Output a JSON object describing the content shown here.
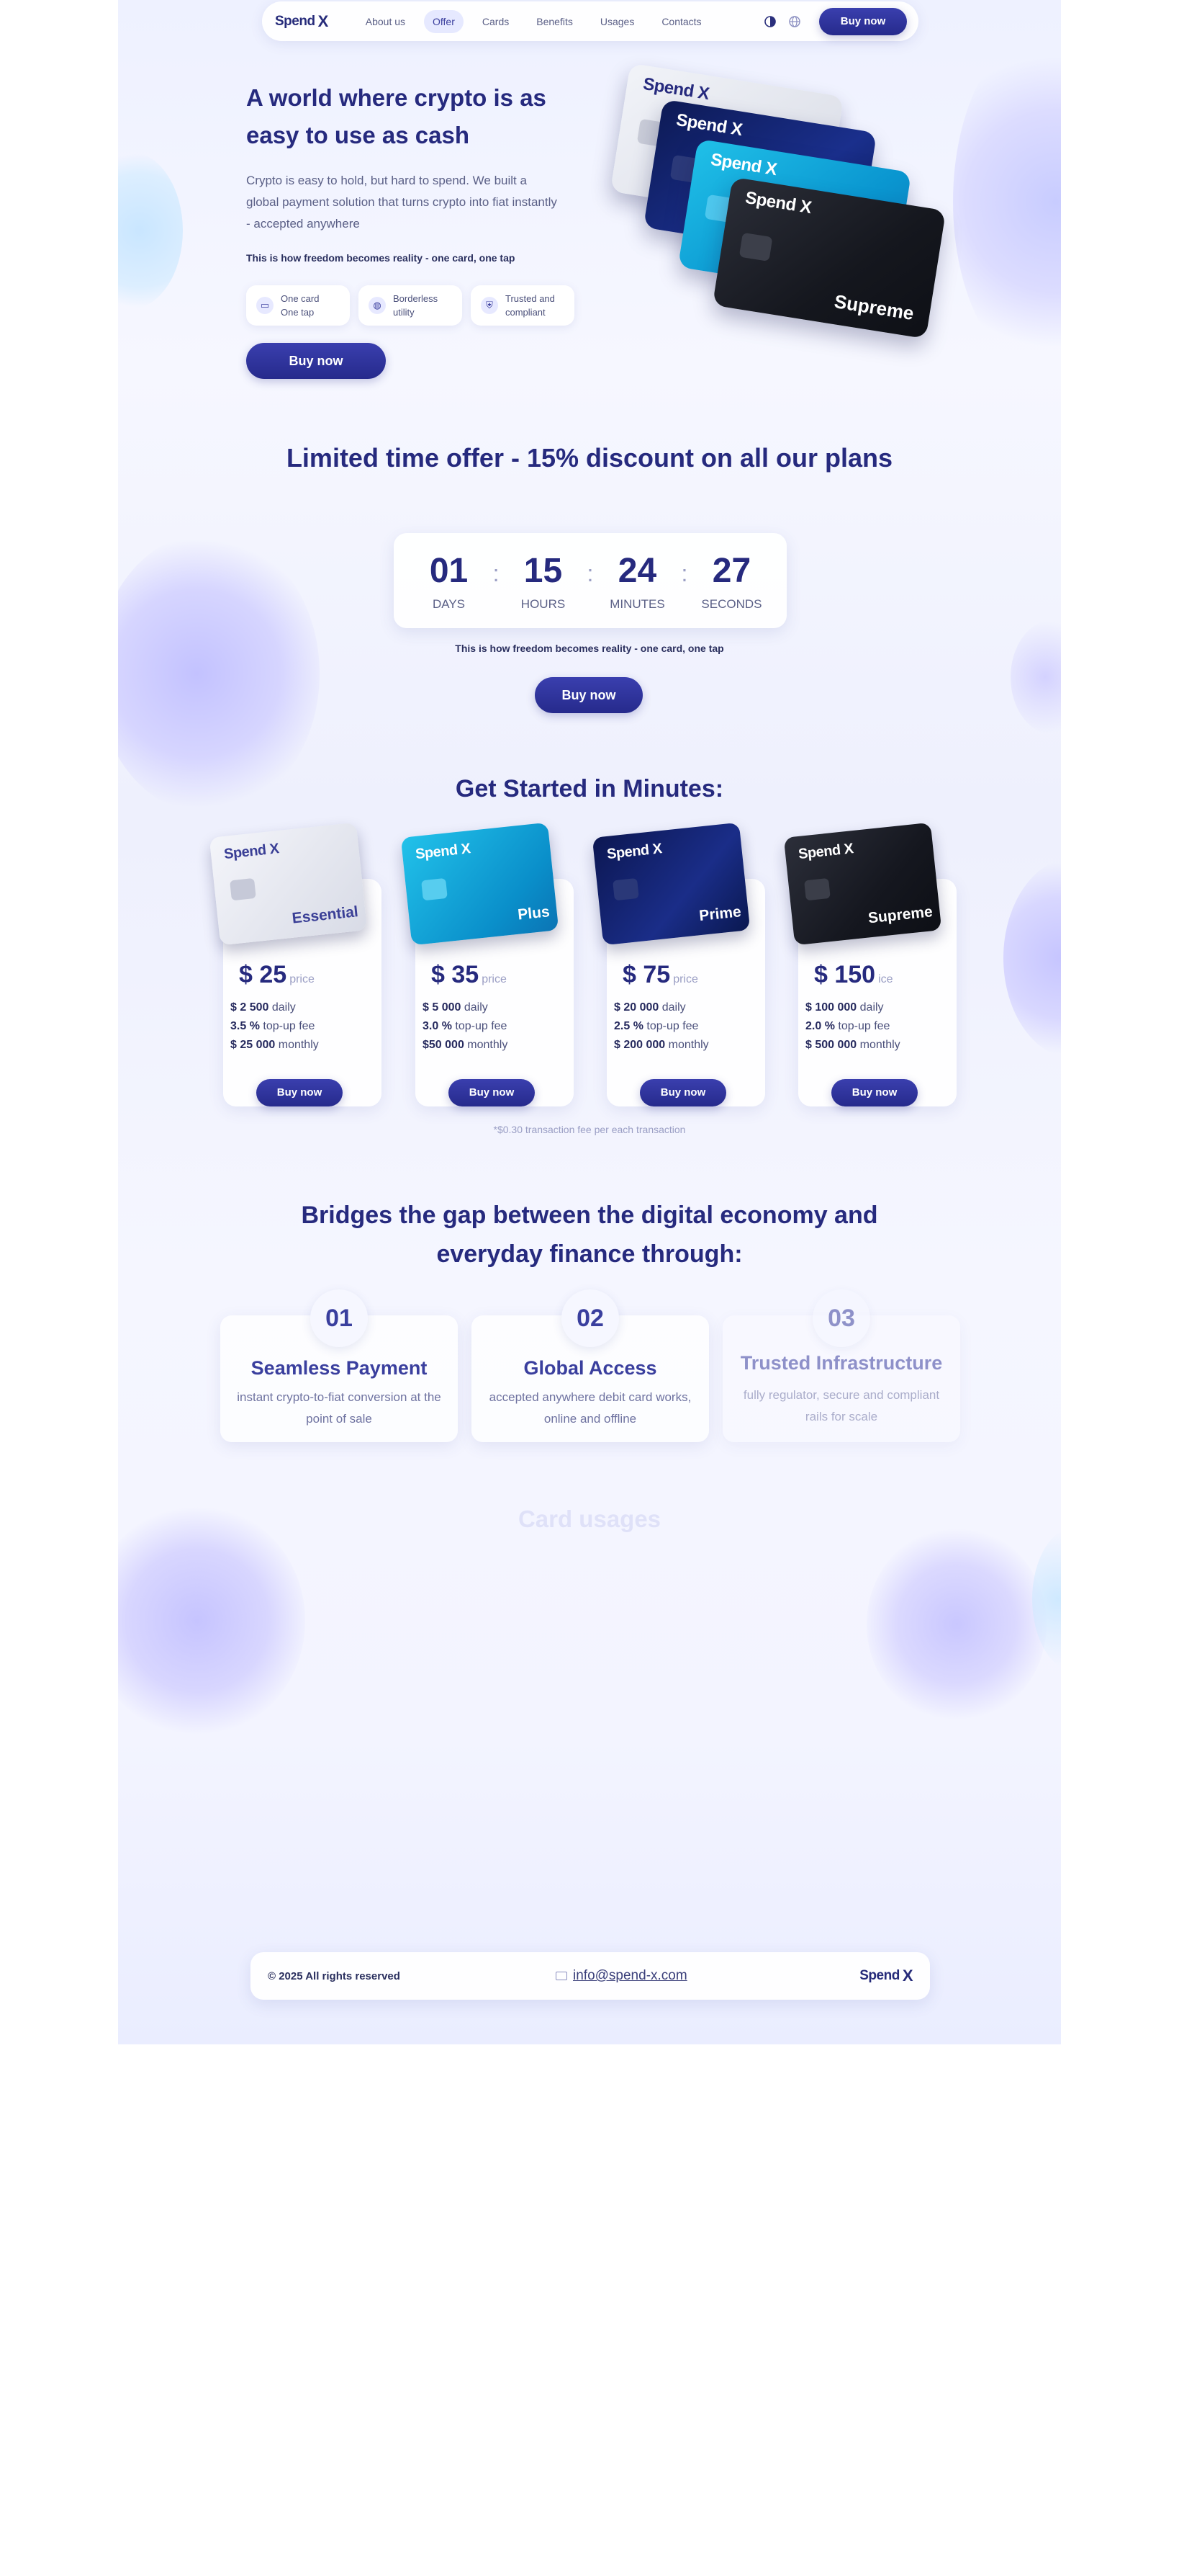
{
  "nav": {
    "brand": "Spend",
    "brand_mark": "X",
    "links": [
      {
        "label": "About us",
        "active": false
      },
      {
        "label": "Offer",
        "active": true
      },
      {
        "label": "Cards",
        "active": false
      },
      {
        "label": "Benefits",
        "active": false
      },
      {
        "label": "Usages",
        "active": false
      },
      {
        "label": "Contacts",
        "active": false
      }
    ],
    "icons": [
      "theme-toggle-icon",
      "globe-icon"
    ],
    "buy_label": "Buy now"
  },
  "hero": {
    "title": "A world where crypto is as easy to use as cash",
    "description": "Crypto is easy to hold, but hard to spend. We built a global payment solution that turns crypto into fiat instantly - accepted anywhere",
    "tagline": "This is how freedom becomes reality - one card, one tap",
    "features": [
      {
        "icon": "card-icon",
        "text": "One card One tap"
      },
      {
        "icon": "globe-icon",
        "text": "Borderless utility"
      },
      {
        "icon": "shield-icon",
        "text": "Trusted and compliant"
      }
    ],
    "buy_label": "Buy now",
    "cards": [
      {
        "brand": "Spend",
        "mark": "X",
        "name": ""
      },
      {
        "brand": "Spend",
        "mark": "X",
        "name": ""
      },
      {
        "brand": "Spend",
        "mark": "X",
        "name": ""
      },
      {
        "brand": "Spend",
        "mark": "X",
        "name": "Supreme"
      }
    ]
  },
  "offer": {
    "title": "Limited time offer - 15% discount on all our plans",
    "countdown": [
      {
        "value": "01",
        "label": "DAYS"
      },
      {
        "value": "15",
        "label": "HOURS"
      },
      {
        "value": "24",
        "label": "MINUTES"
      },
      {
        "value": "27",
        "label": "SECONDS"
      }
    ],
    "separator": ":",
    "tagline": "This is how freedom becomes reality - one card, one tap",
    "buy_label": "Buy now"
  },
  "pricing": {
    "title": "Get Started in Minutes:",
    "plans": [
      {
        "card_name": "Essential",
        "price": "$ 25",
        "price_suffix": "price",
        "daily": "$ 2 500",
        "daily_label": "daily",
        "fee": "3.5 %",
        "fee_label": "top-up fee",
        "monthly": "$ 25 000",
        "monthly_label": "monthly",
        "buy_label": "Buy now"
      },
      {
        "card_name": "Plus",
        "price": "$ 35",
        "price_suffix": "price",
        "daily": "$ 5 000",
        "daily_label": "daily",
        "fee": "3.0 %",
        "fee_label": "top-up fee",
        "monthly": "$50 000",
        "monthly_label": "monthly",
        "buy_label": "Buy now"
      },
      {
        "card_name": "Prime",
        "price": "$ 75",
        "price_suffix": "price",
        "daily": "$ 20 000",
        "daily_label": "daily",
        "fee": "2.5 %",
        "fee_label": "top-up fee",
        "monthly": "$ 200 000",
        "monthly_label": "monthly",
        "buy_label": "Buy now"
      },
      {
        "card_name": "Supreme",
        "price": "$ 150",
        "price_suffix": "ice",
        "daily": "$ 100 000",
        "daily_label": "daily",
        "fee": "2.0 %",
        "fee_label": "top-up fee",
        "monthly": "$ 500 000",
        "monthly_label": "monthly",
        "buy_label": "Buy now"
      }
    ],
    "card_brand": "Spend",
    "card_mark": "X",
    "fee_note": "*$0.30 transaction fee per each transaction"
  },
  "bridges": {
    "title": "Bridges the gap between the digital economy and everyday finance through:",
    "steps": [
      {
        "num": "01",
        "title": "Seamless Payment",
        "desc": "instant crypto-to-fiat conversion at the point of sale"
      },
      {
        "num": "02",
        "title": "Global Access",
        "desc": "accepted anywhere debit card works, online and offline"
      },
      {
        "num": "03",
        "title": "Trusted Infrastructure",
        "desc": "fully regulator, secure and compliant rails for scale"
      }
    ]
  },
  "usage": {
    "title": "Card usages"
  },
  "footer": {
    "copyright": "© 2025 All rights reserved",
    "email": "info@spend-x.com",
    "brand": "Spend",
    "brand_mark": "X"
  }
}
